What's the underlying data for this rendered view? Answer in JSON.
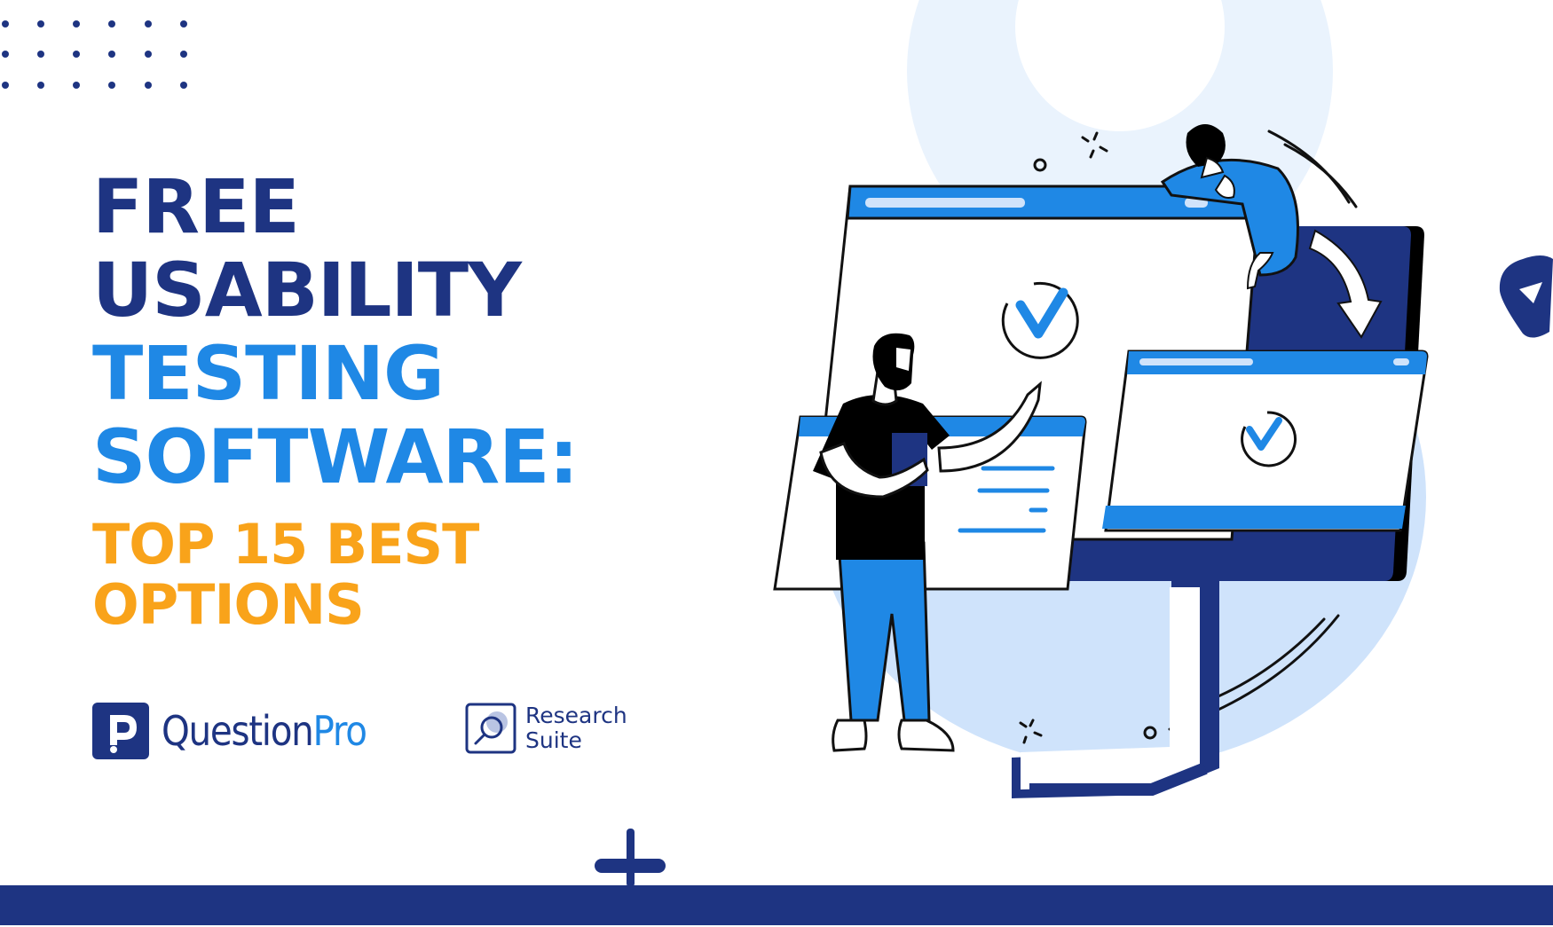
{
  "headline": {
    "line1": "FREE",
    "line2": "USABILITY",
    "line3": "TESTING",
    "line4": "SOFTWARE:"
  },
  "subheadline": {
    "line1": "TOP 15 BEST",
    "line2": "OPTIONS"
  },
  "logos": {
    "questionpro": {
      "word_main": "Question",
      "word_accent": "Pro"
    },
    "research_suite": {
      "line1": "Research",
      "line2": "Suite"
    }
  },
  "icons": {
    "dot_grid": "dot-grid-decoration",
    "play": "play-triangle-icon",
    "plus": "plus-icon",
    "checkmark": "checkmark-icon",
    "arrow": "curved-arrow-down-icon",
    "magnifier": "magnifier-icon"
  },
  "colors": {
    "navy": "#1e3482",
    "blue": "#1f88e5",
    "orange": "#f9a31a",
    "light_blue": "#cfe3fb",
    "pale_blue": "#eaf3fd"
  }
}
